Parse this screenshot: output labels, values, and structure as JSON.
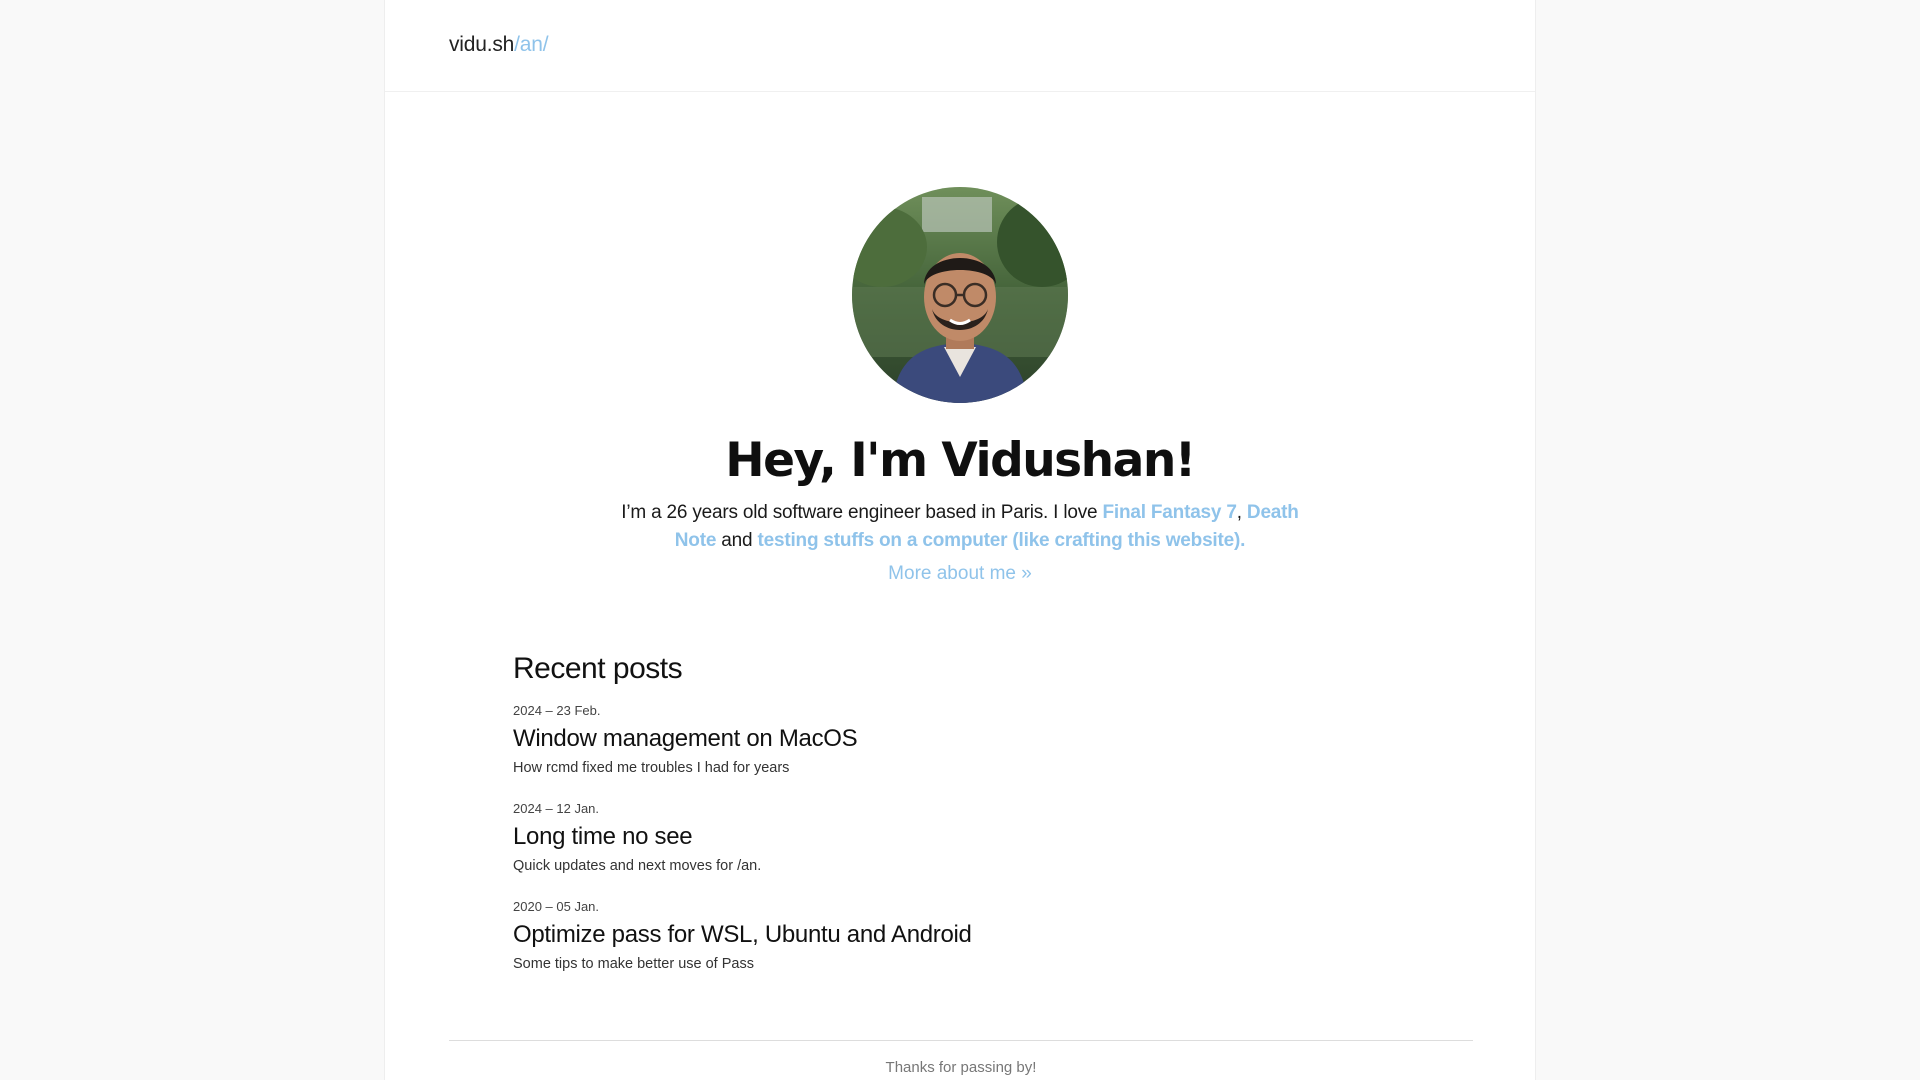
{
  "header": {
    "logo_main": "vidu.sh",
    "logo_accent": "/an/"
  },
  "hero": {
    "avatar_alt": "Profile photo of Vidushan",
    "title": "Hey, I'm Vidushan!",
    "intro_prefix": "I’m a 26 years old software engineer based in Paris. I love ",
    "link_ff7": "Final Fantasy 7",
    "sep_comma": ", ",
    "link_deathnote": "Death Note",
    "sep_and": " and ",
    "link_testing": "testing stuffs on a computer (like crafting this website).",
    "more_link": "More about me »"
  },
  "recent_posts": {
    "title": "Recent posts",
    "items": [
      {
        "date": "2024 – 23 Feb.",
        "title": "Window management on MacOS",
        "description": "How rcmd fixed me troubles I had for years"
      },
      {
        "date": "2024 – 12 Jan.",
        "title": "Long time no see",
        "description": "Quick updates and next moves for /an."
      },
      {
        "date": "2020 – 05 Jan.",
        "title": "Optimize pass for WSL, Ubuntu and Android",
        "description": "Some tips to make better use of Pass"
      }
    ]
  },
  "footer": {
    "text": "Thanks for passing by!"
  },
  "colors": {
    "accent": "#8fc3ea",
    "page_bg": "#f9f9f9",
    "content_bg": "#ffffff"
  }
}
